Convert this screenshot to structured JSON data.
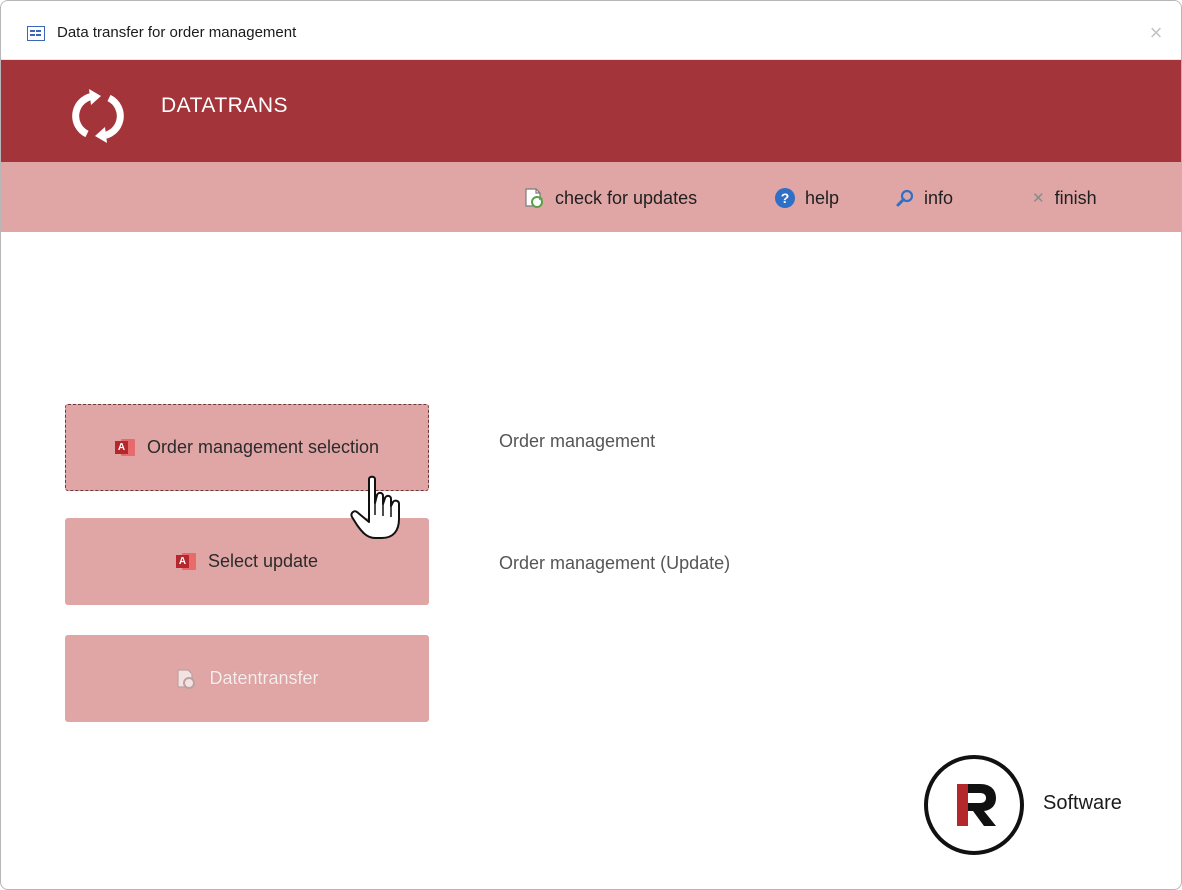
{
  "window": {
    "title": "Data transfer for order management",
    "close_glyph": "×"
  },
  "banner": {
    "title": "DATATRANS",
    "logo_icon": "refresh-icon",
    "color": "#a3343a"
  },
  "toolbar": {
    "color": "#e0a6a6",
    "items": [
      {
        "label": "check for updates",
        "icon": "update-icon"
      },
      {
        "label": "help",
        "icon": "help-icon"
      },
      {
        "label": "info",
        "icon": "search-icon"
      },
      {
        "label": "finish",
        "icon": "close-icon"
      }
    ]
  },
  "main": {
    "buttons": [
      {
        "label": "Order management selection",
        "icon": "access-icon",
        "focused": true,
        "enabled": true
      },
      {
        "label": "Select update",
        "icon": "access-icon",
        "focused": false,
        "enabled": true
      },
      {
        "label": "Datentransfer",
        "icon": "update-icon",
        "focused": false,
        "enabled": false
      }
    ],
    "descriptions": [
      "Order management",
      "Order management  (Update)"
    ]
  },
  "brand": {
    "text": "Software",
    "logo_letter": "R",
    "accent_color": "#b3272d"
  }
}
